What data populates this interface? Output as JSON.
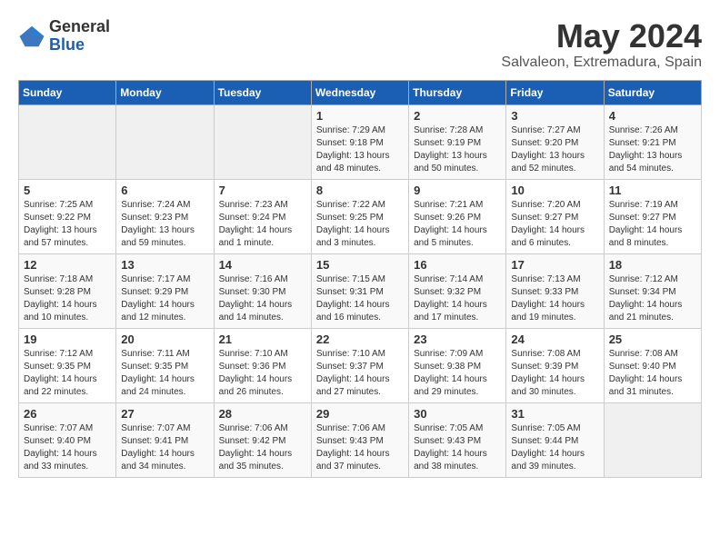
{
  "header": {
    "logo_general": "General",
    "logo_blue": "Blue",
    "month_title": "May 2024",
    "location": "Salvaleon, Extremadura, Spain"
  },
  "days_of_week": [
    "Sunday",
    "Monday",
    "Tuesday",
    "Wednesday",
    "Thursday",
    "Friday",
    "Saturday"
  ],
  "weeks": [
    [
      {
        "day": "",
        "info": ""
      },
      {
        "day": "",
        "info": ""
      },
      {
        "day": "",
        "info": ""
      },
      {
        "day": "1",
        "info": "Sunrise: 7:29 AM\nSunset: 9:18 PM\nDaylight: 13 hours\nand 48 minutes."
      },
      {
        "day": "2",
        "info": "Sunrise: 7:28 AM\nSunset: 9:19 PM\nDaylight: 13 hours\nand 50 minutes."
      },
      {
        "day": "3",
        "info": "Sunrise: 7:27 AM\nSunset: 9:20 PM\nDaylight: 13 hours\nand 52 minutes."
      },
      {
        "day": "4",
        "info": "Sunrise: 7:26 AM\nSunset: 9:21 PM\nDaylight: 13 hours\nand 54 minutes."
      }
    ],
    [
      {
        "day": "5",
        "info": "Sunrise: 7:25 AM\nSunset: 9:22 PM\nDaylight: 13 hours\nand 57 minutes."
      },
      {
        "day": "6",
        "info": "Sunrise: 7:24 AM\nSunset: 9:23 PM\nDaylight: 13 hours\nand 59 minutes."
      },
      {
        "day": "7",
        "info": "Sunrise: 7:23 AM\nSunset: 9:24 PM\nDaylight: 14 hours\nand 1 minute."
      },
      {
        "day": "8",
        "info": "Sunrise: 7:22 AM\nSunset: 9:25 PM\nDaylight: 14 hours\nand 3 minutes."
      },
      {
        "day": "9",
        "info": "Sunrise: 7:21 AM\nSunset: 9:26 PM\nDaylight: 14 hours\nand 5 minutes."
      },
      {
        "day": "10",
        "info": "Sunrise: 7:20 AM\nSunset: 9:27 PM\nDaylight: 14 hours\nand 6 minutes."
      },
      {
        "day": "11",
        "info": "Sunrise: 7:19 AM\nSunset: 9:27 PM\nDaylight: 14 hours\nand 8 minutes."
      }
    ],
    [
      {
        "day": "12",
        "info": "Sunrise: 7:18 AM\nSunset: 9:28 PM\nDaylight: 14 hours\nand 10 minutes."
      },
      {
        "day": "13",
        "info": "Sunrise: 7:17 AM\nSunset: 9:29 PM\nDaylight: 14 hours\nand 12 minutes."
      },
      {
        "day": "14",
        "info": "Sunrise: 7:16 AM\nSunset: 9:30 PM\nDaylight: 14 hours\nand 14 minutes."
      },
      {
        "day": "15",
        "info": "Sunrise: 7:15 AM\nSunset: 9:31 PM\nDaylight: 14 hours\nand 16 minutes."
      },
      {
        "day": "16",
        "info": "Sunrise: 7:14 AM\nSunset: 9:32 PM\nDaylight: 14 hours\nand 17 minutes."
      },
      {
        "day": "17",
        "info": "Sunrise: 7:13 AM\nSunset: 9:33 PM\nDaylight: 14 hours\nand 19 minutes."
      },
      {
        "day": "18",
        "info": "Sunrise: 7:12 AM\nSunset: 9:34 PM\nDaylight: 14 hours\nand 21 minutes."
      }
    ],
    [
      {
        "day": "19",
        "info": "Sunrise: 7:12 AM\nSunset: 9:35 PM\nDaylight: 14 hours\nand 22 minutes."
      },
      {
        "day": "20",
        "info": "Sunrise: 7:11 AM\nSunset: 9:35 PM\nDaylight: 14 hours\nand 24 minutes."
      },
      {
        "day": "21",
        "info": "Sunrise: 7:10 AM\nSunset: 9:36 PM\nDaylight: 14 hours\nand 26 minutes."
      },
      {
        "day": "22",
        "info": "Sunrise: 7:10 AM\nSunset: 9:37 PM\nDaylight: 14 hours\nand 27 minutes."
      },
      {
        "day": "23",
        "info": "Sunrise: 7:09 AM\nSunset: 9:38 PM\nDaylight: 14 hours\nand 29 minutes."
      },
      {
        "day": "24",
        "info": "Sunrise: 7:08 AM\nSunset: 9:39 PM\nDaylight: 14 hours\nand 30 minutes."
      },
      {
        "day": "25",
        "info": "Sunrise: 7:08 AM\nSunset: 9:40 PM\nDaylight: 14 hours\nand 31 minutes."
      }
    ],
    [
      {
        "day": "26",
        "info": "Sunrise: 7:07 AM\nSunset: 9:40 PM\nDaylight: 14 hours\nand 33 minutes."
      },
      {
        "day": "27",
        "info": "Sunrise: 7:07 AM\nSunset: 9:41 PM\nDaylight: 14 hours\nand 34 minutes."
      },
      {
        "day": "28",
        "info": "Sunrise: 7:06 AM\nSunset: 9:42 PM\nDaylight: 14 hours\nand 35 minutes."
      },
      {
        "day": "29",
        "info": "Sunrise: 7:06 AM\nSunset: 9:43 PM\nDaylight: 14 hours\nand 37 minutes."
      },
      {
        "day": "30",
        "info": "Sunrise: 7:05 AM\nSunset: 9:43 PM\nDaylight: 14 hours\nand 38 minutes."
      },
      {
        "day": "31",
        "info": "Sunrise: 7:05 AM\nSunset: 9:44 PM\nDaylight: 14 hours\nand 39 minutes."
      },
      {
        "day": "",
        "info": ""
      }
    ]
  ]
}
